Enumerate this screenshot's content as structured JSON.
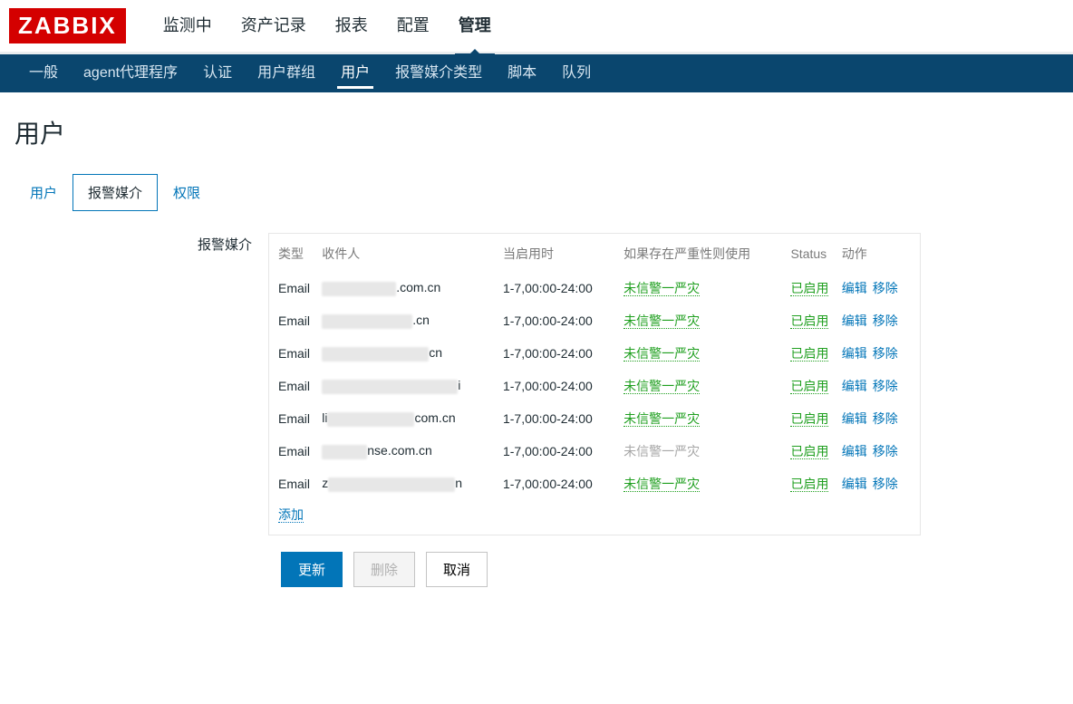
{
  "logo": "ZABBIX",
  "topnav": {
    "items": [
      {
        "label": "监测中"
      },
      {
        "label": "资产记录"
      },
      {
        "label": "报表"
      },
      {
        "label": "配置"
      },
      {
        "label": "管理",
        "active": true
      }
    ]
  },
  "subnav": {
    "items": [
      {
        "label": "一般"
      },
      {
        "label": "agent代理程序"
      },
      {
        "label": "认证"
      },
      {
        "label": "用户群组"
      },
      {
        "label": "用户",
        "active": true
      },
      {
        "label": "报警媒介类型"
      },
      {
        "label": "脚本"
      },
      {
        "label": "队列"
      }
    ]
  },
  "page_title": "用户",
  "tabs": [
    {
      "label": "用户"
    },
    {
      "label": "报警媒介",
      "active": true
    },
    {
      "label": "权限"
    }
  ],
  "section_label": "报警媒介",
  "columns": {
    "type": "类型",
    "recipient": "收件人",
    "when": "当启用时",
    "severity": "如果存在严重性则使用",
    "status": "Status",
    "action": "动作"
  },
  "rows": [
    {
      "type": "Email",
      "recipient_suffix": ".com.cn",
      "blur_w": 82,
      "when": "1-7,00:00-24:00",
      "severity": "未信警一严灾",
      "sev_grey": false,
      "status": "已启用",
      "edit": "编辑",
      "remove": "移除"
    },
    {
      "type": "Email",
      "recipient_suffix": ".cn",
      "blur_w": 100,
      "when": "1-7,00:00-24:00",
      "severity": "未信警一严灾",
      "sev_grey": false,
      "status": "已启用",
      "edit": "编辑",
      "remove": "移除"
    },
    {
      "type": "Email",
      "recipient_suffix": "cn",
      "blur_w": 118,
      "when": "1-7,00:00-24:00",
      "severity": "未信警一严灾",
      "sev_grey": false,
      "status": "已启用",
      "edit": "编辑",
      "remove": "移除"
    },
    {
      "type": "Email",
      "recipient_suffix": "i",
      "blur_w": 150,
      "when": "1-7,00:00-24:00",
      "severity": "未信警一严灾",
      "sev_grey": false,
      "status": "已启用",
      "edit": "编辑",
      "remove": "移除"
    },
    {
      "type": "Email",
      "recipient_prefix": "li",
      "recipient_suffix": "com.cn",
      "blur_w": 96,
      "when": "1-7,00:00-24:00",
      "severity": "未信警一严灾",
      "sev_grey": false,
      "status": "已启用",
      "edit": "编辑",
      "remove": "移除"
    },
    {
      "type": "Email",
      "recipient_suffix": "nse.com.cn",
      "blur_w": 50,
      "when": "1-7,00:00-24:00",
      "severity": "未信警一严灾",
      "sev_grey": true,
      "status": "已启用",
      "edit": "编辑",
      "remove": "移除"
    },
    {
      "type": "Email",
      "recipient_prefix": "z",
      "recipient_suffix": "n",
      "blur_w": 140,
      "when": "1-7,00:00-24:00",
      "severity": "未信警一严灾",
      "sev_grey": false,
      "status": "已启用",
      "edit": "编辑",
      "remove": "移除"
    }
  ],
  "add_link": "添加",
  "buttons": {
    "update": "更新",
    "delete": "删除",
    "cancel": "取消"
  }
}
